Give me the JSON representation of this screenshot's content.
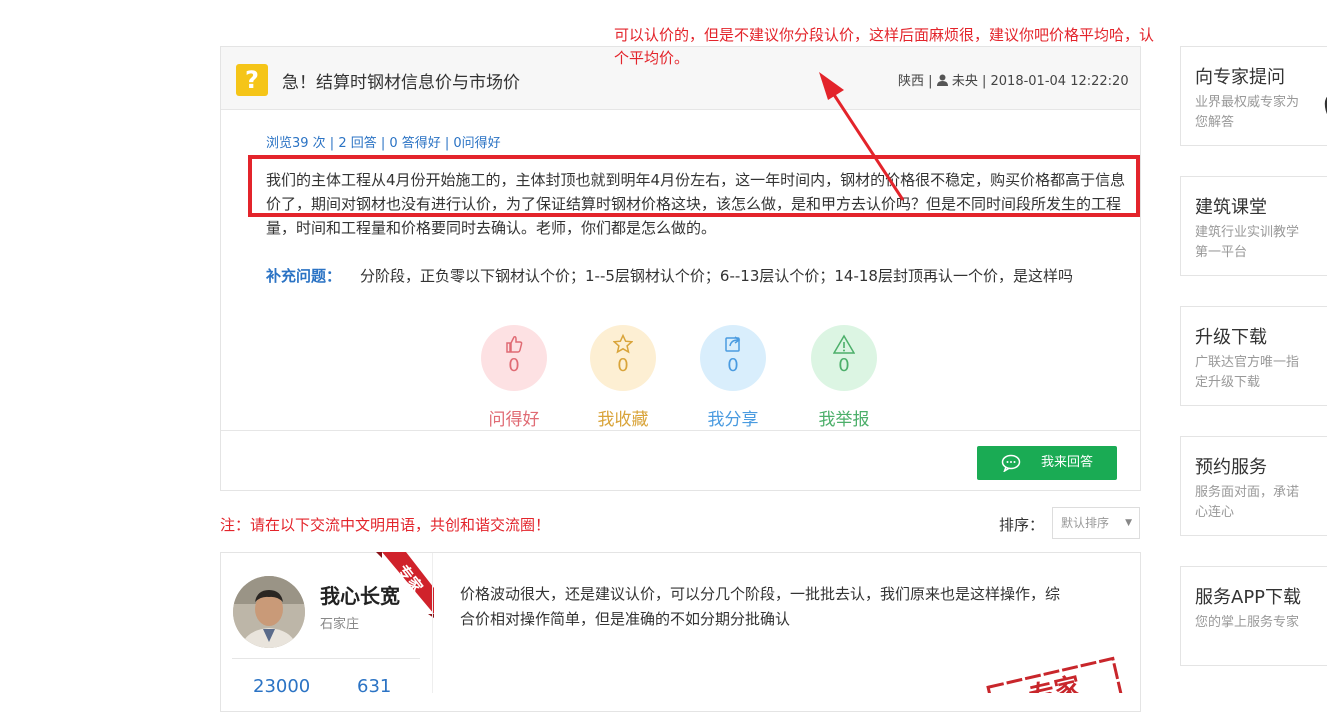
{
  "question": {
    "icon": "question-mark-icon",
    "icon_glyph": "?",
    "title": "急！结算时钢材信息价与市场价",
    "region": "陕西",
    "separator": "|",
    "author": "未央",
    "datetime": "2018-01-04 12:22:20",
    "stats": "浏览39 次 | 2 回答 | 0 答得好 | 0问得好",
    "body": "我们的主体工程从4月份开始施工的，主体封顶也就到明年4月份左右，这一年时间内，钢材的价格很不稳定，购买价格都高于信息价了，期间对钢材也没有进行认价，为了保证结算时钢材价格这块，该怎么做，是和甲方去认价吗？但是不同时间段所发生的工程量，时间和工程量和价格要同时去确认。老师，你们都是怎么做的。",
    "supplement_label": "补充问题：",
    "supplement_text": "分阶段，正负零以下钢材认个价；1--5层钢材认个价；6--13层认个价；14-18层封顶再认一个价，是这样吗"
  },
  "annotation": "可以认价的，但是不建议你分段认价，这样后面麻烦很，建议你吧价格平均哈，认个平均价。",
  "actions": [
    {
      "icon": "thumbs-up-icon",
      "count": "0",
      "label": "问得好",
      "color": "#e06b74",
      "bg": "#fde1e3"
    },
    {
      "icon": "star-icon",
      "count": "0",
      "label": "我收藏",
      "color": "#d9a43a",
      "bg": "#fdefd3"
    },
    {
      "icon": "share-icon",
      "count": "0",
      "label": "我分享",
      "color": "#4a9be0",
      "bg": "#d9eefc"
    },
    {
      "icon": "warning-icon",
      "count": "0",
      "label": "我举报",
      "color": "#4caf6a",
      "bg": "#dcf5e3"
    }
  ],
  "answer_button": {
    "label": "我来回答",
    "icon": "chat-bubble-icon"
  },
  "notice": "注：请在以下交流中文明用语，共创和谐交流圈！",
  "sort": {
    "label": "排序：",
    "value": "默认排序"
  },
  "answer": {
    "name": "我心长宽",
    "location": "石家庄",
    "badge": "专家",
    "stat1": "23000",
    "stat2": "631",
    "text": "价格波动很大，还是建议认价，可以分几个阶段，一批批去认，我们原来也是这样操作，综合价相对操作简单，但是准确的不如分期分批确认",
    "stamp": "专家"
  },
  "sidebar": [
    {
      "title": "向专家提问",
      "sub": "业界最权威专家为您解答"
    },
    {
      "title": "建筑课堂",
      "sub": "建筑行业实训教学第一平台"
    },
    {
      "title": "升级下载",
      "sub": "广联达官方唯一指定升级下载"
    },
    {
      "title": "预约服务",
      "sub": "服务面对面，承诺心连心"
    },
    {
      "title": "服务APP下载",
      "sub": "您的掌上服务专家"
    }
  ]
}
